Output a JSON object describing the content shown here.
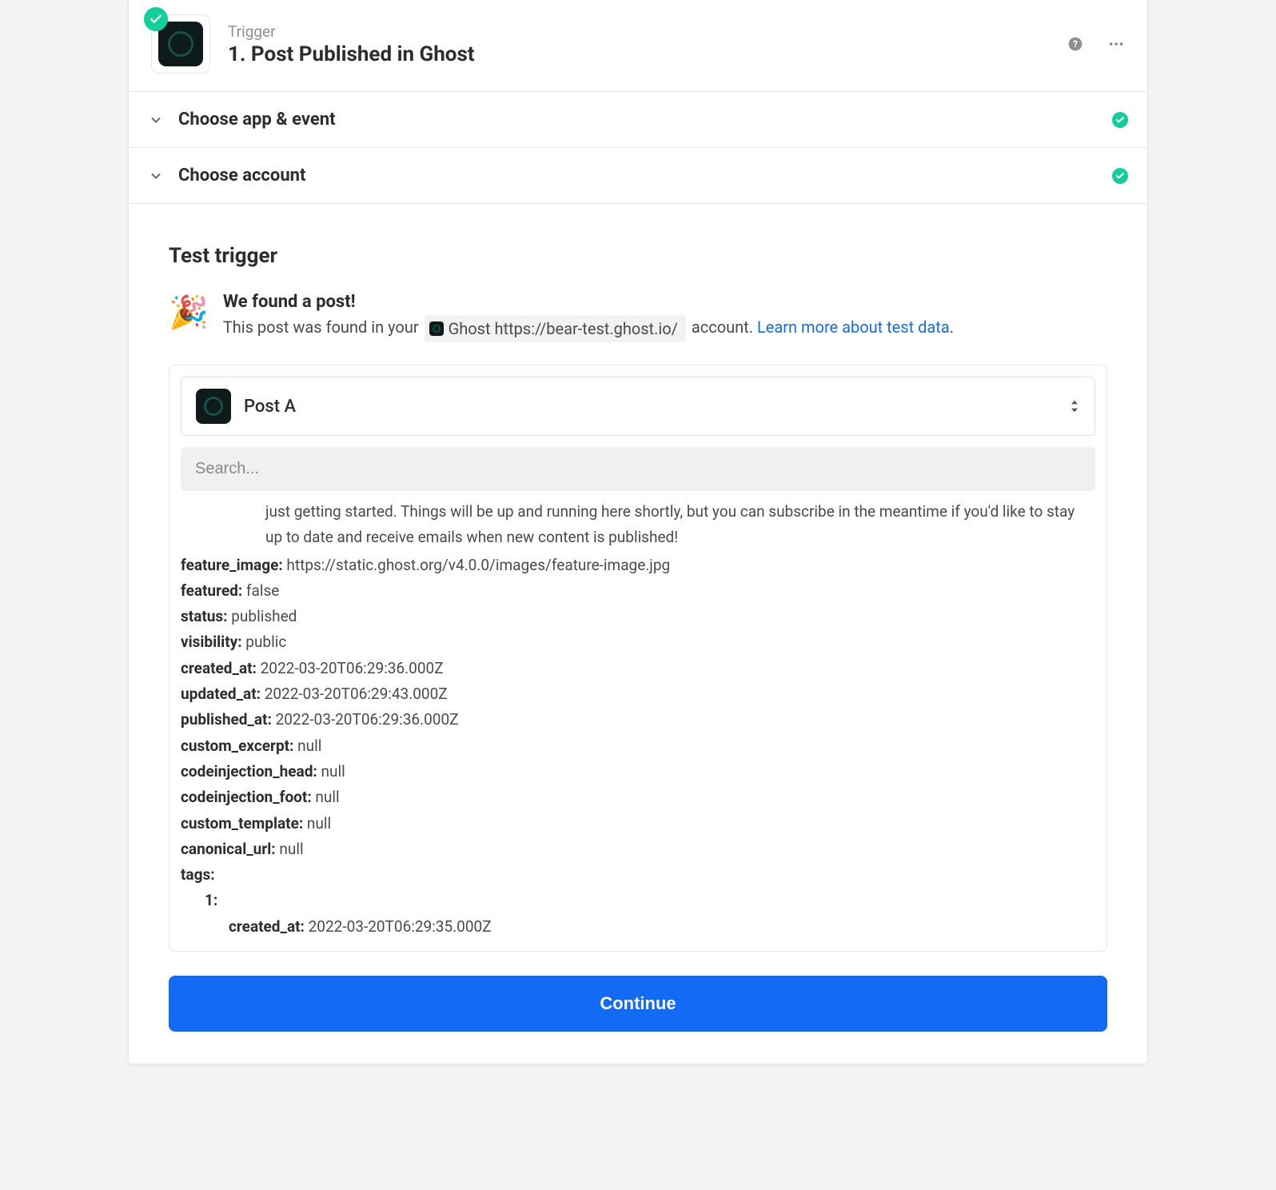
{
  "header": {
    "label": "Trigger",
    "title": "1. Post Published in Ghost"
  },
  "sections": {
    "app_event": "Choose app & event",
    "account": "Choose account"
  },
  "test": {
    "heading": "Test trigger",
    "found_title": "We found a post!",
    "found_desc_prefix": "This post was found in your ",
    "account_chip": "Ghost https://bear-test.ghost.io/",
    "found_desc_suffix": " account. ",
    "learn_more": "Learn more about test data",
    "period": "."
  },
  "post_select": {
    "label": "Post A"
  },
  "search": {
    "placeholder": "Search..."
  },
  "body_text": "just getting started. Things will be up and running here shortly, but you can subscribe in the meantime if you'd like to stay up to date and receive emails when new content is published!",
  "fields": {
    "feature_image": {
      "k": "feature_image:",
      "v": "https://static.ghost.org/v4.0.0/images/feature-image.jpg"
    },
    "featured": {
      "k": "featured:",
      "v": "false"
    },
    "status": {
      "k": "status:",
      "v": "published"
    },
    "visibility": {
      "k": "visibility:",
      "v": "public"
    },
    "created_at": {
      "k": "created_at:",
      "v": "2022-03-20T06:29:36.000Z"
    },
    "updated_at": {
      "k": "updated_at:",
      "v": "2022-03-20T06:29:43.000Z"
    },
    "published_at": {
      "k": "published_at:",
      "v": "2022-03-20T06:29:36.000Z"
    },
    "custom_excerpt": {
      "k": "custom_excerpt:",
      "v": "null"
    },
    "codeinjection_head": {
      "k": "codeinjection_head:",
      "v": "null"
    },
    "codeinjection_foot": {
      "k": "codeinjection_foot:",
      "v": "null"
    },
    "custom_template": {
      "k": "custom_template:",
      "v": "null"
    },
    "canonical_url": {
      "k": "canonical_url:",
      "v": "null"
    },
    "tags": {
      "k": "tags:"
    },
    "tags_1": {
      "k": "1:"
    },
    "tags_1_created": {
      "k": "created_at:",
      "v": "2022-03-20T06:29:35.000Z"
    }
  },
  "continue": "Continue"
}
